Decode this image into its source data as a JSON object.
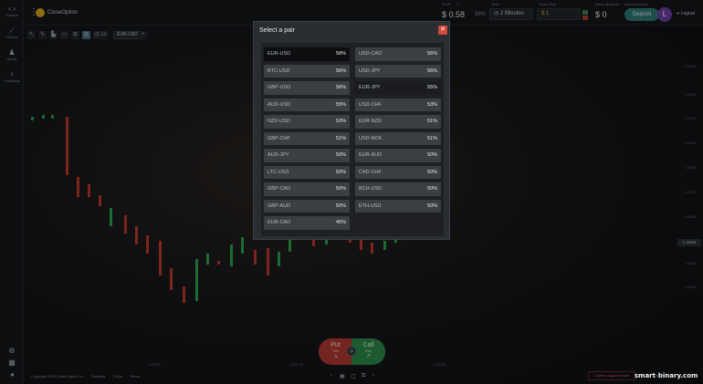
{
  "sidebar": {
    "items": [
      {
        "label": "Expand",
        "icon": "expand-icon",
        "glyph": "‹ ›"
      },
      {
        "label": "Orders",
        "icon": "chart-icon",
        "glyph": "⟋"
      },
      {
        "label": "Social",
        "icon": "person-icon",
        "glyph": "♟"
      },
      {
        "label": "Feedback",
        "icon": "bulb-icon",
        "glyph": "♀"
      }
    ],
    "bottom_glyphs": [
      "⚙",
      "▦",
      "◂"
    ]
  },
  "topbar": {
    "logo_text": "CloseOption",
    "profit_label": "Profit",
    "profit_value": "$ 0.58",
    "payout_pct": "58%",
    "time_label": "Time",
    "time_value": "2 Minutes",
    "trade_size_label": "Trade Size",
    "trade_size_value": "$ 1",
    "demo_balance_label": "Demo Balance",
    "demo_balance_value": "$ 0",
    "demo_account_label": "Demo Account",
    "deposit_label": "Deposit",
    "avatar_letter": "L",
    "logout_label": "Logout"
  },
  "toolbar": {
    "glyphs": [
      "↖",
      "✎",
      "▙",
      "▭",
      "⊞",
      "▦",
      "◷ 1s"
    ],
    "pair_chip": "EUR-USD",
    "add_glyph": "+"
  },
  "chart": {
    "current_price": "1.18390",
    "price_labels": [
      "1.18450",
      "1.18430",
      "1.18410",
      "1.18400",
      "1.18380",
      "1.18370",
      "1.18360",
      "1.18350",
      "1.18340"
    ],
    "time_labels": [
      "10:00:00",
      "10:02:00",
      "10:04:00"
    ],
    "colors": {
      "up": "#2ea44f",
      "down": "#c0392b"
    }
  },
  "trade": {
    "put_label": "Put",
    "put_sub": "Sell",
    "call_label": "Call",
    "call_sub": "Buy",
    "put_arrow": "↘",
    "call_arrow": "↗",
    "center_glyph": "◎"
  },
  "footer": {
    "copyright": "Copyright 2019 CloseOption Co.",
    "links": [
      "Tutorials",
      "FAQs",
      "Terms"
    ],
    "nav_glyphs": [
      "‹",
      "▣",
      "▢",
      "⧉",
      "›"
    ],
    "chat_label": "Contact support team"
  },
  "watermark": {
    "prefix": "smart",
    "dot": "-",
    "suffix": "binary.com"
  },
  "modal": {
    "title": "Select a pair",
    "close_glyph": "✕",
    "pairs": [
      {
        "name": "EUR-USD",
        "pct": "58%",
        "state": "active"
      },
      {
        "name": "USD-CAD",
        "pct": "56%",
        "state": ""
      },
      {
        "name": "BTC-USD",
        "pct": "56%",
        "state": ""
      },
      {
        "name": "USD-JPY",
        "pct": "56%",
        "state": ""
      },
      {
        "name": "GBP-USD",
        "pct": "56%",
        "state": ""
      },
      {
        "name": "EUR-JPY",
        "pct": "55%",
        "state": "hover"
      },
      {
        "name": "AUD-USD",
        "pct": "55%",
        "state": ""
      },
      {
        "name": "USD-CHF",
        "pct": "53%",
        "state": ""
      },
      {
        "name": "NZD-USD",
        "pct": "53%",
        "state": ""
      },
      {
        "name": "EUR-NZD",
        "pct": "51%",
        "state": ""
      },
      {
        "name": "GBP-CHF",
        "pct": "51%",
        "state": ""
      },
      {
        "name": "USD-NOK",
        "pct": "51%",
        "state": ""
      },
      {
        "name": "AUD-JPY",
        "pct": "50%",
        "state": ""
      },
      {
        "name": "EUR-AUD",
        "pct": "50%",
        "state": ""
      },
      {
        "name": "LTC-USD",
        "pct": "50%",
        "state": ""
      },
      {
        "name": "CAD-CHF",
        "pct": "50%",
        "state": ""
      },
      {
        "name": "GBP-CAD",
        "pct": "50%",
        "state": ""
      },
      {
        "name": "BCH-USD",
        "pct": "50%",
        "state": ""
      },
      {
        "name": "GBP-AUD",
        "pct": "50%",
        "state": ""
      },
      {
        "name": "ETH-USD",
        "pct": "50%",
        "state": ""
      },
      {
        "name": "EUR-CAD",
        "pct": "45%",
        "state": ""
      }
    ]
  }
}
